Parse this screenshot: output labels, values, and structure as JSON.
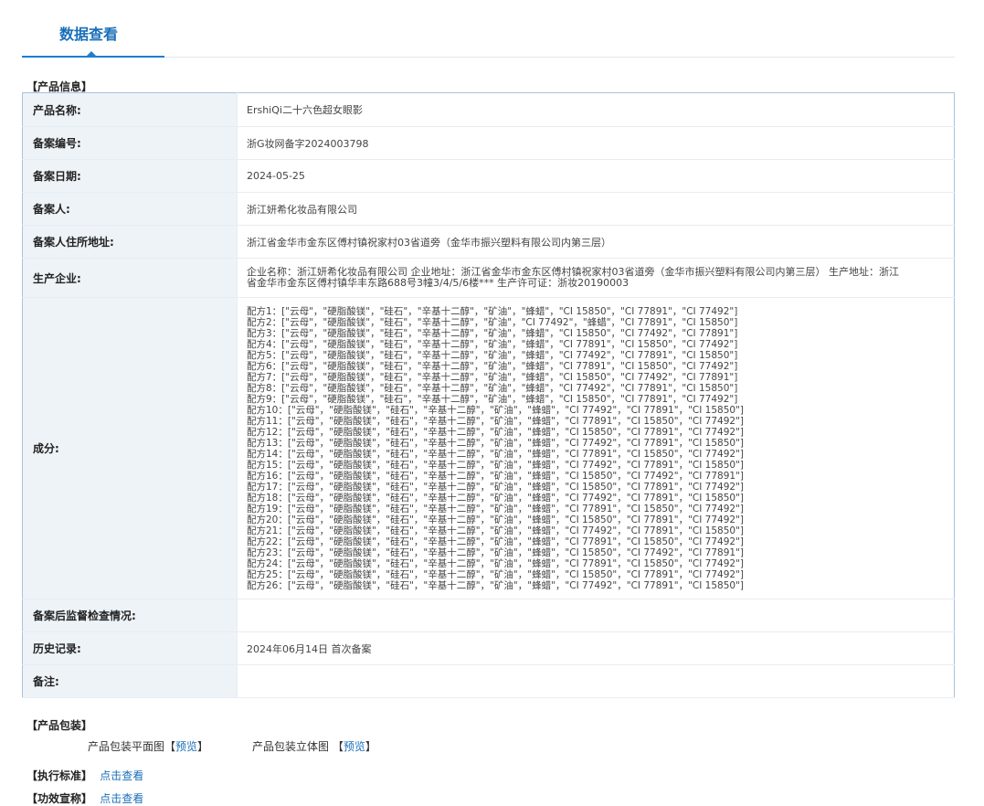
{
  "tab": {
    "label": "数据查看"
  },
  "sections": {
    "product_info": "【产品信息】",
    "packaging": "【产品包装】",
    "standard": "【执行标准】",
    "efficacy": "【功效宣称】"
  },
  "fields": {
    "name_label": "产品名称:",
    "name_value": "ErshiQi二十六色超女眼影",
    "reg_no_label": "备案编号:",
    "reg_no_value": "浙G妆网备字2024003798",
    "reg_date_label": "备案日期:",
    "reg_date_value": "2024-05-25",
    "registrant_label": "备案人:",
    "registrant_value": "浙江妍希化妆品有限公司",
    "address_label": "备案人住所地址:",
    "address_value": "浙江省金华市金东区傅村镇祝家村03省道旁（金华市振兴塑料有限公司内第三层）",
    "manufacturer_label": "生产企业:",
    "manufacturer_value": "企业名称：浙江妍希化妆品有限公司 企业地址：浙江省金华市金东区傅村镇祝家村03省道旁（金华市振兴塑料有限公司内第三层） 生产地址：浙江省金华市金东区傅村镇华丰东路688号3幢3/4/5/6楼*** 生产许可证：浙妆20190003",
    "ingredients_label": "成分:",
    "supervision_label": "备案后监督检查情况:",
    "supervision_value": "",
    "history_label": "历史记录:",
    "history_value": "2024年06月14日 首次备案",
    "remark_label": "备注:",
    "remark_value": ""
  },
  "ingredients": [
    "配方1：[\"云母\"，\"硬脂酸镁\"，\"硅石\"，\"辛基十二醇\"，\"矿油\"，\"蜂蜡\"，\"CI 15850\"，\"CI 77891\"，\"CI 77492\"]",
    "配方2：[\"云母\"，\"硬脂酸镁\"，\"硅石\"，\"辛基十二醇\"，\"矿油\"，\"CI 77492\"，\"蜂蜡\"，\"CI 77891\"，\"CI 15850\"]",
    "配方3：[\"云母\"，\"硬脂酸镁\"，\"硅石\"，\"辛基十二醇\"，\"矿油\"，\"蜂蜡\"，\"CI 15850\"，\"CI 77492\"，\"CI 77891\"]",
    "配方4：[\"云母\"，\"硬脂酸镁\"，\"硅石\"，\"辛基十二醇\"，\"矿油\"，\"蜂蜡\"，\"CI 77891\"，\"CI 15850\"，\"CI 77492\"]",
    "配方5：[\"云母\"，\"硬脂酸镁\"，\"硅石\"，\"辛基十二醇\"，\"矿油\"，\"蜂蜡\"，\"CI 77492\"，\"CI 77891\"，\"CI 15850\"]",
    "配方6：[\"云母\"，\"硬脂酸镁\"，\"硅石\"，\"辛基十二醇\"，\"矿油\"，\"蜂蜡\"，\"CI 77891\"，\"CI 15850\"，\"CI 77492\"]",
    "配方7：[\"云母\"，\"硬脂酸镁\"，\"硅石\"，\"辛基十二醇\"，\"矿油\"，\"蜂蜡\"，\"CI 15850\"，\"CI 77492\"，\"CI 77891\"]",
    "配方8：[\"云母\"，\"硬脂酸镁\"，\"硅石\"，\"辛基十二醇\"，\"矿油\"，\"蜂蜡\"，\"CI 77492\"，\"CI 77891\"，\"CI 15850\"]",
    "配方9：[\"云母\"，\"硬脂酸镁\"，\"硅石\"，\"辛基十二醇\"，\"矿油\"，\"蜂蜡\"，\"CI 15850\"，\"CI 77891\"，\"CI 77492\"]",
    "配方10：[\"云母\"，\"硬脂酸镁\"，\"硅石\"，\"辛基十二醇\"，\"矿油\"，\"蜂蜡\"，\"CI 77492\"，\"CI 77891\"，\"CI 15850\"]",
    "配方11：[\"云母\"，\"硬脂酸镁\"，\"硅石\"，\"辛基十二醇\"，\"矿油\"，\"蜂蜡\"，\"CI 77891\"，\"CI 15850\"，\"CI 77492\"]",
    "配方12：[\"云母\"，\"硬脂酸镁\"，\"硅石\"，\"辛基十二醇\"，\"矿油\"，\"蜂蜡\"，\"CI 15850\"，\"CI 77891\"，\"CI 77492\"]",
    "配方13：[\"云母\"，\"硬脂酸镁\"，\"硅石\"，\"辛基十二醇\"，\"矿油\"，\"蜂蜡\"，\"CI 77492\"，\"CI 77891\"，\"CI 15850\"]",
    "配方14：[\"云母\"，\"硬脂酸镁\"，\"硅石\"，\"辛基十二醇\"，\"矿油\"，\"蜂蜡\"，\"CI 77891\"，\"CI 15850\"，\"CI 77492\"]",
    "配方15：[\"云母\"，\"硬脂酸镁\"，\"硅石\"，\"辛基十二醇\"，\"矿油\"，\"蜂蜡\"，\"CI 77492\"，\"CI 77891\"，\"CI 15850\"]",
    "配方16：[\"云母\"，\"硬脂酸镁\"，\"硅石\"，\"辛基十二醇\"，\"矿油\"，\"蜂蜡\"，\"CI 15850\"，\"CI 77492\"，\"CI 77891\"]",
    "配方17：[\"云母\"，\"硬脂酸镁\"，\"硅石\"，\"辛基十二醇\"，\"矿油\"，\"蜂蜡\"，\"CI 15850\"，\"CI 77891\"，\"CI 77492\"]",
    "配方18：[\"云母\"，\"硬脂酸镁\"，\"硅石\"，\"辛基十二醇\"，\"矿油\"，\"蜂蜡\"，\"CI 77492\"，\"CI 77891\"，\"CI 15850\"]",
    "配方19：[\"云母\"，\"硬脂酸镁\"，\"硅石\"，\"辛基十二醇\"，\"矿油\"，\"蜂蜡\"，\"CI 77891\"，\"CI 15850\"，\"CI 77492\"]",
    "配方20：[\"云母\"，\"硬脂酸镁\"，\"硅石\"，\"辛基十二醇\"，\"矿油\"，\"蜂蜡\"，\"CI 15850\"，\"CI 77891\"，\"CI 77492\"]",
    "配方21：[\"云母\"，\"硬脂酸镁\"，\"硅石\"，\"辛基十二醇\"，\"矿油\"，\"蜂蜡\"，\"CI 77492\"，\"CI 77891\"，\"CI 15850\"]",
    "配方22：[\"云母\"，\"硬脂酸镁\"，\"硅石\"，\"辛基十二醇\"，\"矿油\"，\"蜂蜡\"，\"CI 77891\"，\"CI 15850\"，\"CI 77492\"]",
    "配方23：[\"云母\"，\"硬脂酸镁\"，\"硅石\"，\"辛基十二醇\"，\"矿油\"，\"蜂蜡\"，\"CI 15850\"，\"CI 77492\"，\"CI 77891\"]",
    "配方24：[\"云母\"，\"硬脂酸镁\"，\"硅石\"，\"辛基十二醇\"，\"矿油\"，\"蜂蜡\"，\"CI 77891\"，\"CI 15850\"，\"CI 77492\"]",
    "配方25：[\"云母\"，\"硬脂酸镁\"，\"硅石\"，\"辛基十二醇\"，\"矿油\"，\"蜂蜡\"，\"CI 15850\"，\"CI 77891\"，\"CI 77492\"]",
    "配方26：[\"云母\"，\"硬脂酸镁\"，\"硅石\"，\"辛基十二醇\"，\"矿油\"，\"蜂蜡\"，\"CI 77492\"，\"CI 77891\"，\"CI 15850\"]"
  ],
  "packaging": {
    "flat_label": "产品包装平面图",
    "flat_link": "预览",
    "solid_label": "产品包装立体图",
    "solid_link": "预览",
    "bracket_open": "【",
    "bracket_close": "】"
  },
  "links": {
    "standard": "点击查看",
    "efficacy": "点击查看"
  },
  "colors": {
    "accent": "#1e7fcf",
    "link": "#1a6fb8",
    "label_bg": "#eef3f8",
    "border": "#a9c3dc"
  }
}
